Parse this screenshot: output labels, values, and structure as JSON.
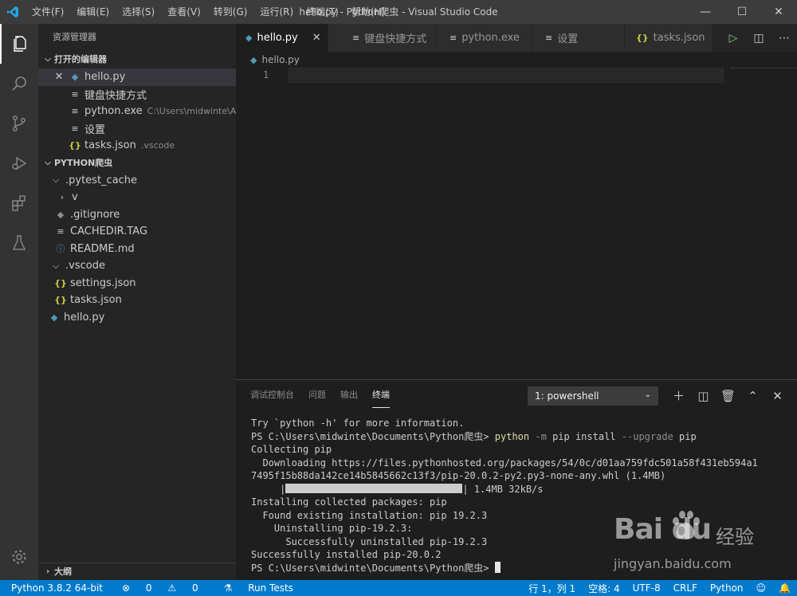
{
  "titlebar": {
    "menus": [
      "文件(F)",
      "编辑(E)",
      "选择(S)",
      "查看(V)",
      "转到(G)",
      "运行(R)",
      "终端(T)",
      "帮助(H)"
    ],
    "title": "hello.py - Python爬虫 - Visual Studio Code"
  },
  "sidebar": {
    "title": "资源管理器",
    "open_editors_label": "打开的编辑器",
    "open_editors": [
      {
        "name": "hello.py",
        "desc": "",
        "icon": "python-file-icon"
      },
      {
        "name": "键盘快捷方式",
        "desc": "",
        "icon": "text-file-icon"
      },
      {
        "name": "python.exe",
        "desc": "C:\\Users\\midwinte\\App...",
        "icon": "text-file-icon"
      },
      {
        "name": "设置",
        "desc": "",
        "icon": "text-file-icon"
      },
      {
        "name": "tasks.json",
        "desc": ".vscode",
        "icon": "json-file-icon"
      }
    ],
    "workspace_label": "PYTHON爬虫",
    "tree": [
      {
        "name": ".pytest_cache"
      },
      {
        "name": "v"
      },
      {
        "name": ".gitignore"
      },
      {
        "name": "CACHEDIR.TAG"
      },
      {
        "name": "README.md"
      },
      {
        "name": ".vscode"
      },
      {
        "name": "settings.json"
      },
      {
        "name": "tasks.json"
      },
      {
        "name": "hello.py"
      }
    ],
    "outline_label": "大纲"
  },
  "tabs": [
    {
      "label": "hello.py",
      "active": true
    },
    {
      "label": "键盘快捷方式"
    },
    {
      "label": "python.exe"
    },
    {
      "label": "设置"
    },
    {
      "label": "tasks.json"
    }
  ],
  "editor": {
    "breadcrumb": "hello.py",
    "line_number": "1"
  },
  "panel": {
    "tabs": [
      "调试控制台",
      "问题",
      "输出",
      "终端"
    ],
    "terminal_select": "1: powershell",
    "lines": {
      "l1": "Try `python -h' for more information.",
      "prompt": "PS C:\\Users\\midwinte\\Documents\\Python爬虫>",
      "cmd_python": "python",
      "cmd_flag_m": "-m",
      "cmd_rest1": "pip install",
      "cmd_flag_up": "--upgrade",
      "cmd_rest2": "pip",
      "l3": "Collecting pip",
      "l4": "  Downloading https://files.pythonhosted.org/packages/54/0c/d01aa759fdc501a58f431eb594a1",
      "l5": "7495f15b88da142ce14b5845662c13f3/pip-20.0.2-py2.py3-none-any.whl (1.4MB)",
      "l6_pre": "     |",
      "l6_post": "| 1.4MB 32kB/s",
      "l7": "Installing collected packages: pip",
      "l8": "  Found existing installation: pip 19.2.3",
      "l9": "    Uninstalling pip-19.2.3:",
      "l10": "      Successfully uninstalled pip-19.2.3",
      "l11": "Successfully installed pip-20.0.2",
      "final_prompt": "PS C:\\Users\\midwinte\\Documents\\Python爬虫>"
    },
    "progress": 1.0
  },
  "statusbar": {
    "interpreter": "Python 3.8.2 64-bit",
    "errors": "0",
    "warnings": "0",
    "run_tests": "Run Tests",
    "cursor_pos": "行 1，列 1",
    "indent": "空格: 4",
    "encoding": "UTF-8",
    "eol": "CRLF",
    "language": "Python"
  },
  "watermark": {
    "brand": "Bai du",
    "cn": "经验",
    "url": "jingyan.baidu.com"
  },
  "colors": {
    "accent": "#007acc",
    "python_icon": "#519aba",
    "json_icon": "#cbcb41",
    "run_icon": "#89d185"
  }
}
